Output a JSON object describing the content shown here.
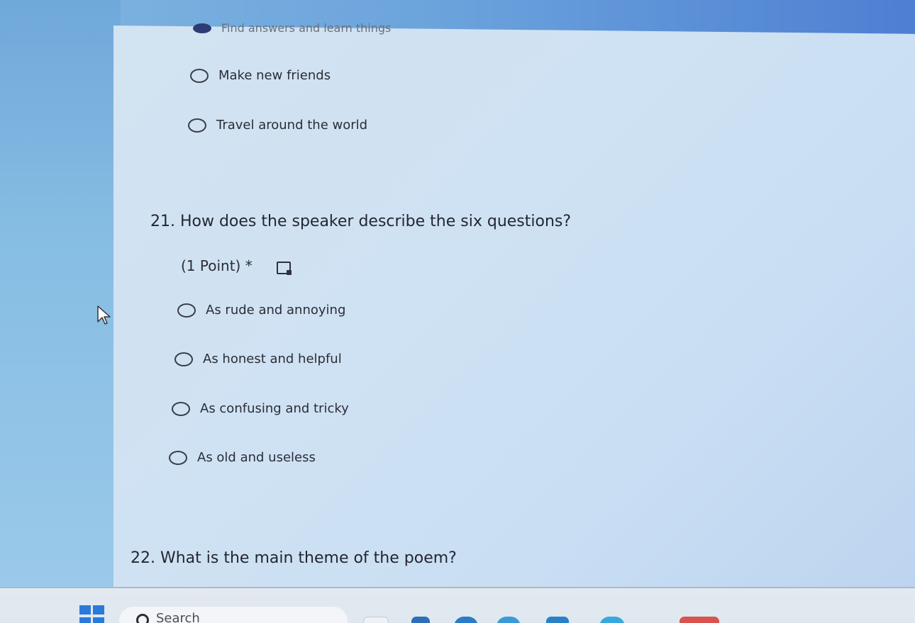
{
  "prev_question": {
    "options": [
      "Find answers and learn things",
      "Make new friends",
      "Travel around the world"
    ]
  },
  "q21": {
    "title": "21. How does the speaker describe the six questions?",
    "points": "(1 Point) *",
    "options": [
      "As rude and annoying",
      "As honest and helpful",
      "As confusing and tricky",
      "As old and useless"
    ]
  },
  "q22": {
    "title": "22. What is the main theme of the poem?"
  },
  "taskbar": {
    "search_label": "Search"
  },
  "colors": {
    "accent": "#2f3b73",
    "start": "#2a7ad9"
  }
}
